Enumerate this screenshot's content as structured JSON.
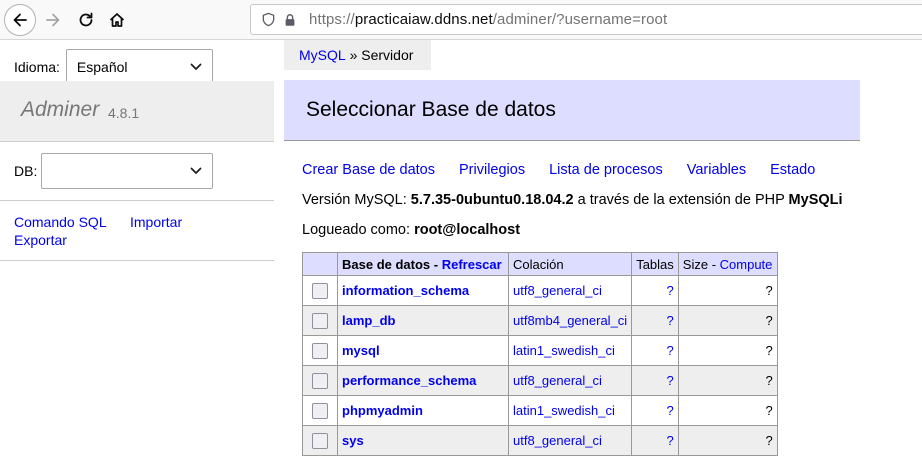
{
  "browser": {
    "url_scheme": "https://",
    "url_host": "practicaiaw.ddns.net",
    "url_path": "/adminer/?username=root",
    "icons": [
      "back-arrow-icon",
      "forward-arrow-icon",
      "reload-icon",
      "home-icon",
      "shield-icon",
      "lock-icon"
    ]
  },
  "sidebar": {
    "lang_label": "Idioma:",
    "lang_value": "Español",
    "brand_name": "Adminer",
    "brand_version": "4.8.1",
    "db_label": "DB:",
    "db_value": "",
    "links": {
      "sql": "Comando SQL",
      "import": "Importar",
      "export": "Exportar"
    }
  },
  "breadcrumb": {
    "mysql": "MySQL",
    "sep": " » ",
    "current": "Servidor"
  },
  "heading": "Seleccionar Base de datos",
  "menu": [
    "Crear Base de datos",
    "Privilegios",
    "Lista de procesos",
    "Variables",
    "Estado"
  ],
  "info": {
    "version_prefix": "Versión MySQL: ",
    "version": "5.7.35-0ubuntu0.18.04.2",
    "version_mid": " a través de la extensión de PHP ",
    "extension": "MySQLi",
    "logged_prefix": "Logueado como: ",
    "logged_user": "root@localhost"
  },
  "table": {
    "headers": {
      "name": "Base de datos",
      "name_sep": " - ",
      "refresh": "Refrescar",
      "collation": "Colación",
      "tables": "Tablas",
      "size": "Size",
      "size_sep": " - ",
      "compute": "Compute"
    },
    "rows": [
      {
        "name": "information_schema",
        "collation": "utf8_general_ci",
        "tables": "?",
        "size": "?"
      },
      {
        "name": "lamp_db",
        "collation": "utf8mb4_general_ci",
        "tables": "?",
        "size": "?"
      },
      {
        "name": "mysql",
        "collation": "latin1_swedish_ci",
        "tables": "?",
        "size": "?"
      },
      {
        "name": "performance_schema",
        "collation": "utf8_general_ci",
        "tables": "?",
        "size": "?"
      },
      {
        "name": "phpmyadmin",
        "collation": "latin1_swedish_ci",
        "tables": "?",
        "size": "?"
      },
      {
        "name": "sys",
        "collation": "utf8_general_ci",
        "tables": "?",
        "size": "?"
      }
    ]
  },
  "colors": {
    "link": "#0000ee",
    "heading_bg": "#ddddff",
    "sidebar_bg": "#eeeeee"
  }
}
